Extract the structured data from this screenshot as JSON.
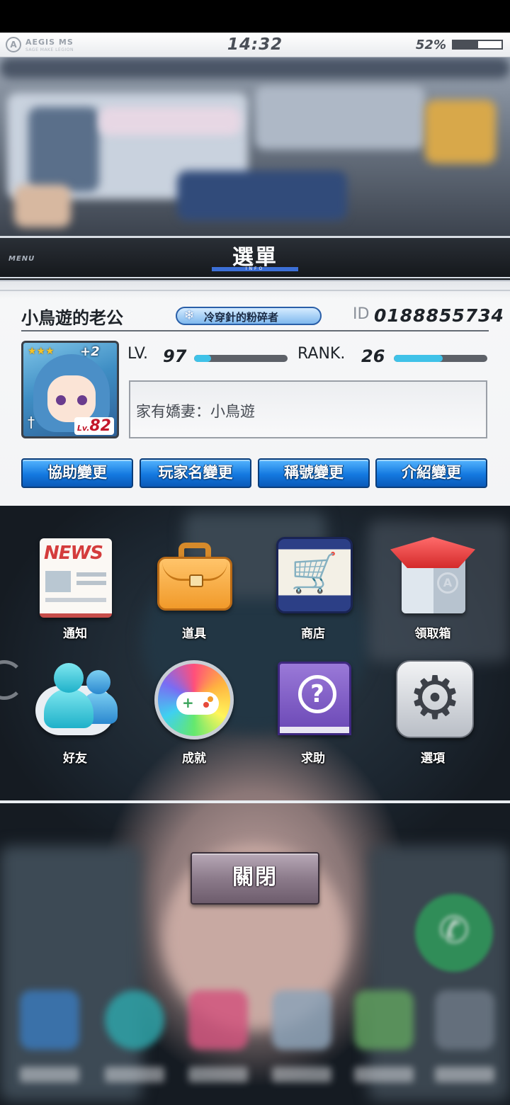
{
  "status_bar": {
    "brand": "AEGIS MS",
    "brand_sub": "SAGE MAKE LEGION",
    "time": "14:32",
    "battery_text": "52%",
    "battery_level": 0.52
  },
  "menu_header": {
    "small_label": "MENU",
    "title": "選單",
    "sub_label": "INFO"
  },
  "profile": {
    "player_name": "小鳥遊的老公",
    "title_badge": "冷穿針的粉碎者",
    "id_label": "ID",
    "id_value": "0188855734",
    "avatar": {
      "stars": "★★★",
      "plus": "+2",
      "lv_prefix": "Lv.",
      "lv_value": "82"
    },
    "level_label": "LV.",
    "level_value": "97",
    "level_progress": 0.18,
    "rank_label": "RANK.",
    "rank_value": "26",
    "rank_progress": 0.52,
    "intro_text": "家有嬌妻：小鳥遊"
  },
  "profile_buttons": [
    {
      "label": "協助變更"
    },
    {
      "label": "玩家名變更"
    },
    {
      "label": "稱號變更"
    },
    {
      "label": "介紹變更"
    }
  ],
  "menu_items": [
    {
      "label": "通知",
      "icon": "news-icon"
    },
    {
      "label": "道具",
      "icon": "briefcase-icon"
    },
    {
      "label": "商店",
      "icon": "shopping-cart-icon"
    },
    {
      "label": "領取箱",
      "icon": "gift-box-icon"
    },
    {
      "label": "好友",
      "icon": "friends-icon"
    },
    {
      "label": "成就",
      "icon": "gamepad-icon"
    },
    {
      "label": "求助",
      "icon": "help-book-icon"
    },
    {
      "label": "選項",
      "icon": "gear-icon"
    }
  ],
  "news_icon_text": "NEWS",
  "close_button": {
    "label": "關閉"
  },
  "colors": {
    "accent_blue": "#1479e0",
    "progress_cyan": "#3fc2e8",
    "close_button": "#8c7b8b"
  }
}
